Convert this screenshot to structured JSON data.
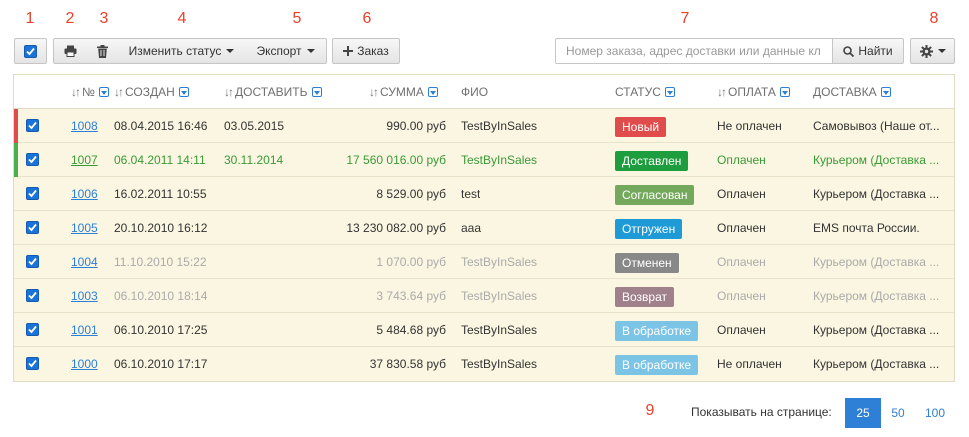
{
  "markers": [
    "1",
    "2",
    "3",
    "4",
    "5",
    "6",
    "7",
    "8",
    "9"
  ],
  "toolbar": {
    "change_status_label": "Изменить статус",
    "export_label": "Экспорт",
    "add_order_label": "Заказ",
    "search_placeholder": "Номер заказа, адрес доставки или данные кл",
    "search_button_label": "Найти"
  },
  "columns": {
    "num": "№",
    "created": "СОЗДАН",
    "deliver": "ДОСТАВИТЬ",
    "sum": "СУММА",
    "fio": "ФИО",
    "status": "СТАТУС",
    "payment": "ОПЛАТА",
    "delivery": "ДОСТАВКА"
  },
  "orders": [
    {
      "num": "1008",
      "created": "08.04.2015 16:46",
      "deliver": "03.05.2015",
      "sum": "990.00 руб",
      "fio": "TestByInSales",
      "status": "Новый",
      "status_color": "#e04b4b",
      "payment": "Не оплачен",
      "delivery": "Самовывоз (Наше от...",
      "stripe": "#e04b4b",
      "tone": "normal"
    },
    {
      "num": "1007",
      "created": "06.04.2011 14:11",
      "deliver": "30.11.2014",
      "sum": "17 560 016.00 руб",
      "fio": "TestByInSales",
      "status": "Доставлен",
      "status_color": "#1e9d3e",
      "payment": "Оплачен",
      "delivery": "Курьером (Доставка ...",
      "stripe": "#4caf50",
      "tone": "green"
    },
    {
      "num": "1006",
      "created": "16.02.2011 10:55",
      "deliver": "",
      "sum": "8 529.00 руб",
      "fio": "test",
      "status": "Согласован",
      "status_color": "#74a85c",
      "payment": "Оплачен",
      "delivery": "Курьером (Доставка ...",
      "stripe": "",
      "tone": "normal"
    },
    {
      "num": "1005",
      "created": "20.10.2010 16:12",
      "deliver": "",
      "sum": "13 230 082.00 руб",
      "fio": "aaa",
      "status": "Отгружен",
      "status_color": "#1e9ad6",
      "payment": "Оплачен",
      "delivery": "EMS почта России.",
      "stripe": "",
      "tone": "normal"
    },
    {
      "num": "1004",
      "created": "11.10.2010 15:22",
      "deliver": "",
      "sum": "1 070.00 руб",
      "fio": "TestByInSales",
      "status": "Отменен",
      "status_color": "#888888",
      "payment": "Оплачен",
      "delivery": "Курьером (Доставка ...",
      "stripe": "",
      "tone": "grey"
    },
    {
      "num": "1003",
      "created": "06.10.2010 18:14",
      "deliver": "",
      "sum": "3 743.64 руб",
      "fio": "TestByInSales",
      "status": "Возврат",
      "status_color": "#a0808a",
      "payment": "Оплачен",
      "delivery": "Курьером (Доставка ...",
      "stripe": "",
      "tone": "grey"
    },
    {
      "num": "1001",
      "created": "06.10.2010 17:25",
      "deliver": "",
      "sum": "5 484.68 руб",
      "fio": "TestByInSales",
      "status": "В обработке",
      "status_color": "#7cc4e6",
      "payment": "Оплачен",
      "delivery": "Курьером (Доставка ...",
      "stripe": "",
      "tone": "normal"
    },
    {
      "num": "1000",
      "created": "06.10.2010 17:17",
      "deliver": "",
      "sum": "37 830.58 руб",
      "fio": "TestByInSales",
      "status": "В обработке",
      "status_color": "#7cc4e6",
      "payment": "Не оплачен",
      "delivery": "Курьером (Доставка ...",
      "stripe": "",
      "tone": "normal"
    }
  ],
  "pagination": {
    "label": "Показывать на странице:",
    "options": [
      "25",
      "50",
      "100"
    ],
    "selected": "25"
  },
  "colors": {
    "accent": "#2e7fd6",
    "marker": "#e8412c",
    "row_bg": "#fbf6e2"
  },
  "icons": {
    "select_all": "checkbox-icon",
    "print": "print-icon",
    "delete": "trash-icon",
    "add": "plus-icon",
    "search": "search-icon",
    "settings": "gear-icon"
  }
}
